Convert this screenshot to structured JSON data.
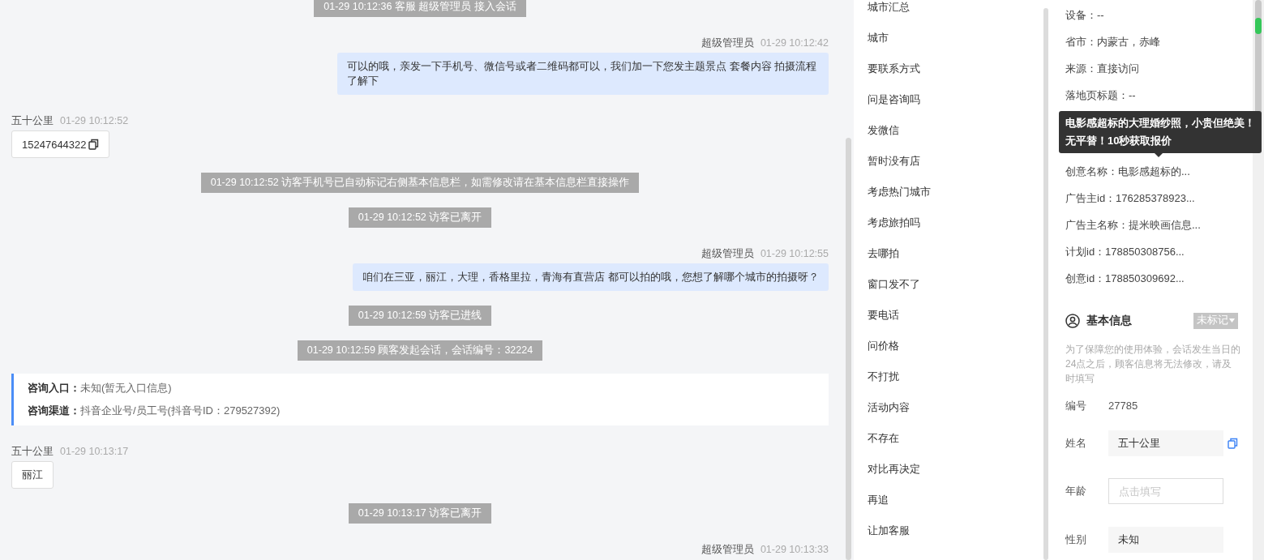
{
  "chat": {
    "messages": [
      {
        "kind": "system",
        "text": "01-29 10:12:36 客服 超级管理员 接入会话"
      },
      {
        "kind": "agent",
        "sender": "超级管理员",
        "time": "01-29 10:12:42",
        "text": "可以的哦，亲发一下手机号、微信号或者二维码都可以，我们加一下您发主题景点 套餐内容 拍摄流程了解下"
      },
      {
        "kind": "visitor",
        "sender": "五十公里",
        "time": "01-29 10:12:52",
        "text": "15247644322",
        "copyable": true
      },
      {
        "kind": "system",
        "text": "01-29 10:12:52 访客手机号已自动标记右侧基本信息栏，如需修改请在基本信息栏直接操作"
      },
      {
        "kind": "system",
        "text": "01-29 10:12:52 访客已离开"
      },
      {
        "kind": "agent",
        "sender": "超级管理员",
        "time": "01-29 10:12:55",
        "text": "咱们在三亚，丽江，大理，香格里拉，青海有直营店 都可以拍的哦，您想了解哪个城市的拍摄呀？"
      },
      {
        "kind": "system",
        "text": "01-29 10:12:59 访客已进线"
      },
      {
        "kind": "system",
        "text": "01-29 10:12:59 顾客发起会话，会话编号：32224"
      },
      {
        "kind": "info",
        "lines": [
          {
            "label": "咨询入口：",
            "value": "未知(暂无入口信息)"
          },
          {
            "label": "咨询渠道：",
            "value": "抖音企业号/员工号(抖音号ID：279527392)"
          }
        ]
      },
      {
        "kind": "visitor",
        "sender": "五十公里",
        "time": "01-29 10:13:17",
        "text": "丽江",
        "copyable": false
      },
      {
        "kind": "system",
        "text": "01-29 10:13:17 访客已离开"
      },
      {
        "kind": "agent_header",
        "sender": "超级管理员",
        "time": "01-29 10:13:33"
      }
    ]
  },
  "tags": [
    "城市汇总",
    "城市",
    "要联系方式",
    "问是咨询吗",
    "发微信",
    "暂时没有店",
    "考虑热门城市",
    "考虑旅拍吗",
    "去哪拍",
    "窗口发不了",
    "要电话",
    "问价格",
    "不打扰",
    "活动内容",
    "不存在",
    "对比再决定",
    "再追",
    "让加客服"
  ],
  "details": {
    "rows_before": [
      "设备：--",
      "省市：内蒙古，赤峰",
      "来源：直接访问",
      "落地页标题：--"
    ],
    "tooltip": "电影感超标的大理婚纱照，小贵但绝美！无平替！10秒获取报价",
    "rows_after": [
      "创意名称：电影感超标的...",
      "广告主id：176285378923...",
      "广告主名称：提米映画信息...",
      "计划id：178850308756...",
      "创意id：178850309692..."
    ]
  },
  "basic_info": {
    "title": "基本信息",
    "status": "未标记",
    "notice": "为了保障您的使用体验，会话发生当日的24点之后，顾客信息将无法修改，请及时填写",
    "fields": [
      {
        "kind": "text",
        "label": "编号",
        "value": "27785"
      },
      {
        "kind": "readonly",
        "label": "姓名",
        "value": "五十公里",
        "copyable": true
      },
      {
        "kind": "input",
        "label": "年龄",
        "placeholder": "点击填写"
      },
      {
        "kind": "readonly",
        "label": "性别",
        "value": "未知",
        "copyable": false
      }
    ]
  }
}
